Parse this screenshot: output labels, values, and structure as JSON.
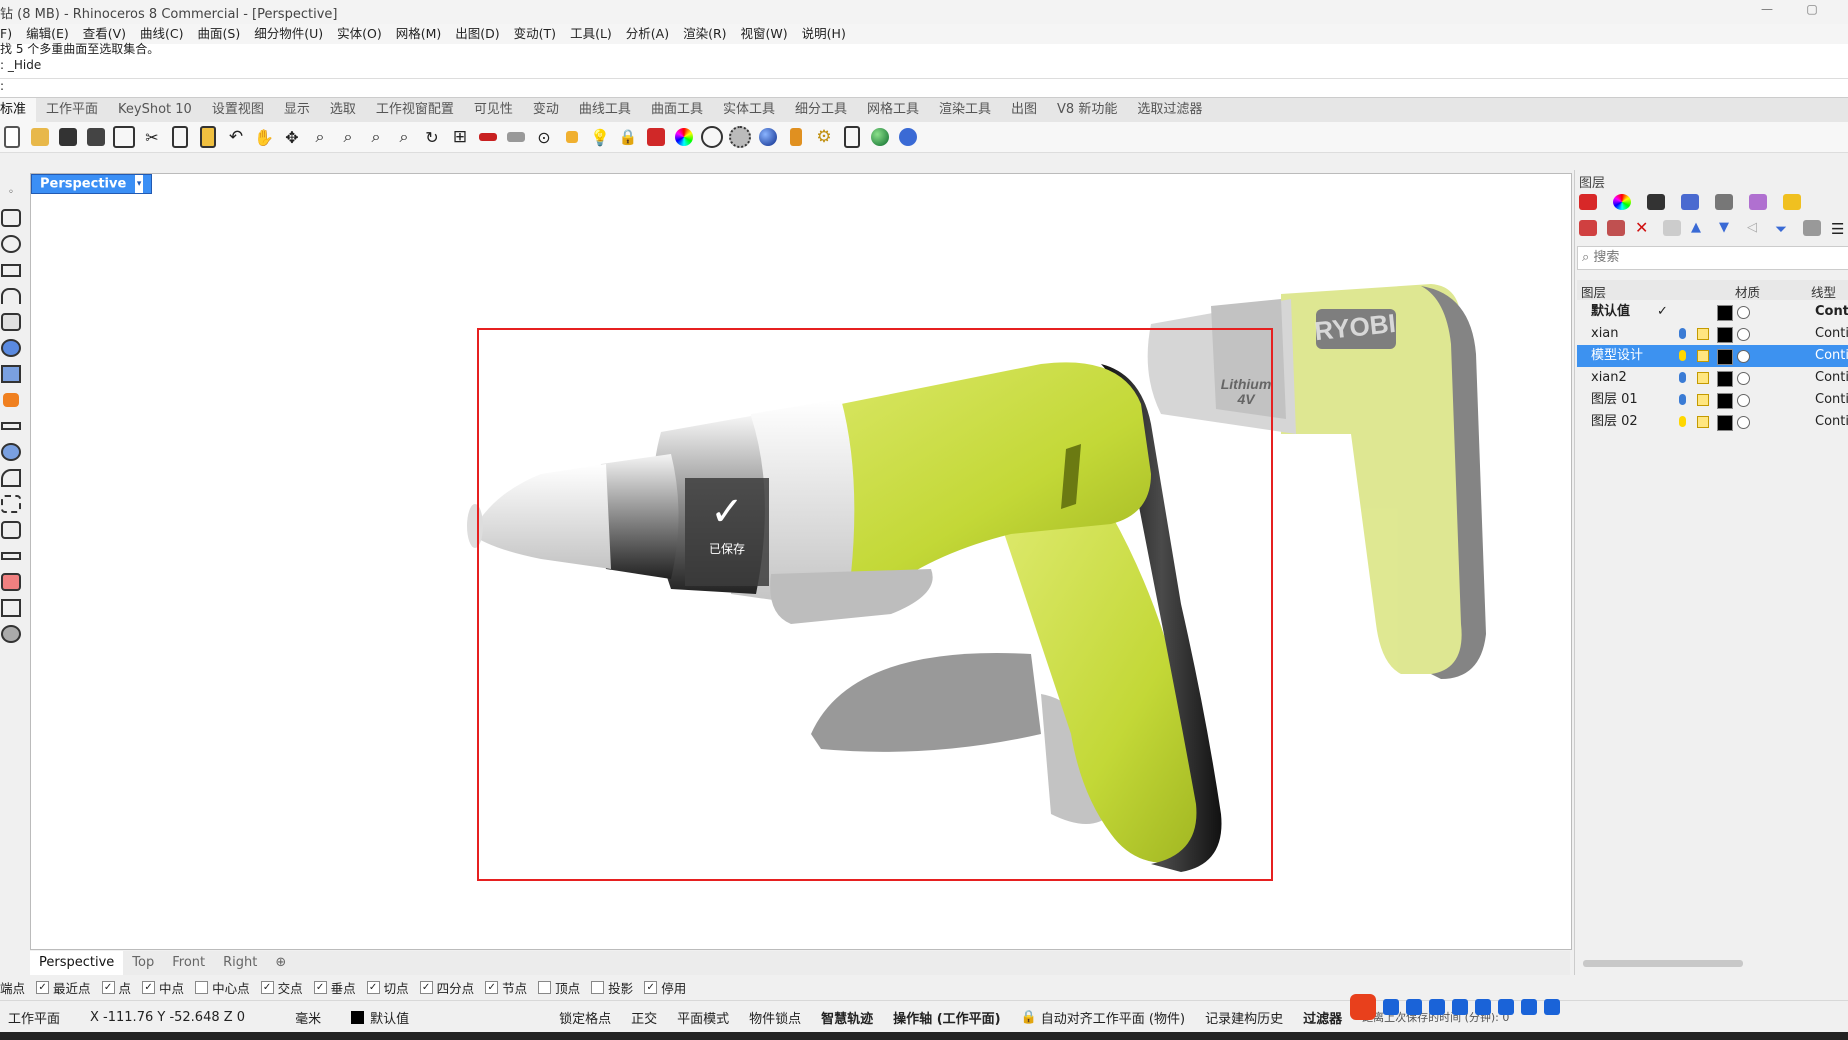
{
  "window": {
    "title": "钻 (8 MB) - Rhinoceros 8 Commercial - [Perspective]",
    "minimize": "—",
    "restore": "▢"
  },
  "menu": [
    "F)",
    "编辑(E)",
    "查看(V)",
    "曲线(C)",
    "曲面(S)",
    "细分物件(U)",
    "实体(O)",
    "网格(M)",
    "出图(D)",
    "变动(T)",
    "工具(L)",
    "分析(A)",
    "渲染(R)",
    "视窗(W)",
    "说明(H)"
  ],
  "command": {
    "history_line1": "找 5 个多重曲面至选取集合。",
    "history_line2": ": _Hide",
    "prompt": ":"
  },
  "toolbar_tabs": [
    "标准",
    "工作平面",
    "KeyShot 10",
    "设置视图",
    "显示",
    "选取",
    "工作视窗配置",
    "可见性",
    "变动",
    "曲线工具",
    "曲面工具",
    "实体工具",
    "细分工具",
    "网格工具",
    "渲染工具",
    "出图",
    "V8 新功能",
    "选取过滤器"
  ],
  "viewport": {
    "name": "Perspective",
    "tabs": [
      "Perspective",
      "Top",
      "Front",
      "Right"
    ],
    "add_tab": "⊕",
    "saved_toast": "已保存",
    "brand_text": "RYOBI",
    "battery_label": "Lithium",
    "battery_volt": "4V"
  },
  "osnap": {
    "items": [
      {
        "label": "端点",
        "checked": true,
        "show_box": false
      },
      {
        "label": "最近点",
        "checked": true
      },
      {
        "label": "点",
        "checked": true
      },
      {
        "label": "中点",
        "checked": true
      },
      {
        "label": "中心点",
        "checked": false
      },
      {
        "label": "交点",
        "checked": true
      },
      {
        "label": "垂点",
        "checked": true
      },
      {
        "label": "切点",
        "checked": true
      },
      {
        "label": "四分点",
        "checked": true
      },
      {
        "label": "节点",
        "checked": true
      },
      {
        "label": "顶点",
        "checked": false
      },
      {
        "label": "投影",
        "checked": false
      },
      {
        "label": "停用",
        "checked": true
      }
    ]
  },
  "status": {
    "cplane": "工作平面",
    "coords": "X -111.76 Y -52.648 Z 0",
    "units": "毫米",
    "layer": "默认值",
    "grid_snap": "锁定格点",
    "ortho": "正交",
    "planar": "平面模式",
    "osnap": "物件锁点",
    "smarttrack": "智慧轨迹",
    "gumball": "操作轴 (工作平面)",
    "autoalign": "自动对齐工作平面 (物件)",
    "history": "记录建构历史",
    "filter": "过滤器",
    "tail": "距离上次保存的时间 (分钟): 0"
  },
  "layers_panel": {
    "title": "图层",
    "search_placeholder": "搜索",
    "columns": {
      "name": "图层",
      "material": "材质",
      "linetype": "线型"
    },
    "rows": [
      {
        "name": "默认值",
        "current": true,
        "check": "✓",
        "bulb_color": "",
        "linetype": "Conti",
        "selected": false
      },
      {
        "name": "xian",
        "check": "",
        "bulb_color": "#3a7bd5",
        "linetype": "Conti",
        "selected": false
      },
      {
        "name": "模型设计",
        "check": "",
        "bulb_color": "#ffd700",
        "linetype": "Conti",
        "selected": true
      },
      {
        "name": "xian2",
        "check": "",
        "bulb_color": "#3a7bd5",
        "linetype": "Conti",
        "selected": false
      },
      {
        "name": "图层 01",
        "check": "",
        "bulb_color": "#3a7bd5",
        "linetype": "Conti",
        "selected": false
      },
      {
        "name": "图层 02",
        "check": "",
        "bulb_color": "#ffd700",
        "linetype": "Conti",
        "selected": false
      }
    ]
  },
  "colors": {
    "accent_blue": "#3b8ff5",
    "drill_green": "#c6d93a",
    "highlight_red": "#e62020"
  }
}
